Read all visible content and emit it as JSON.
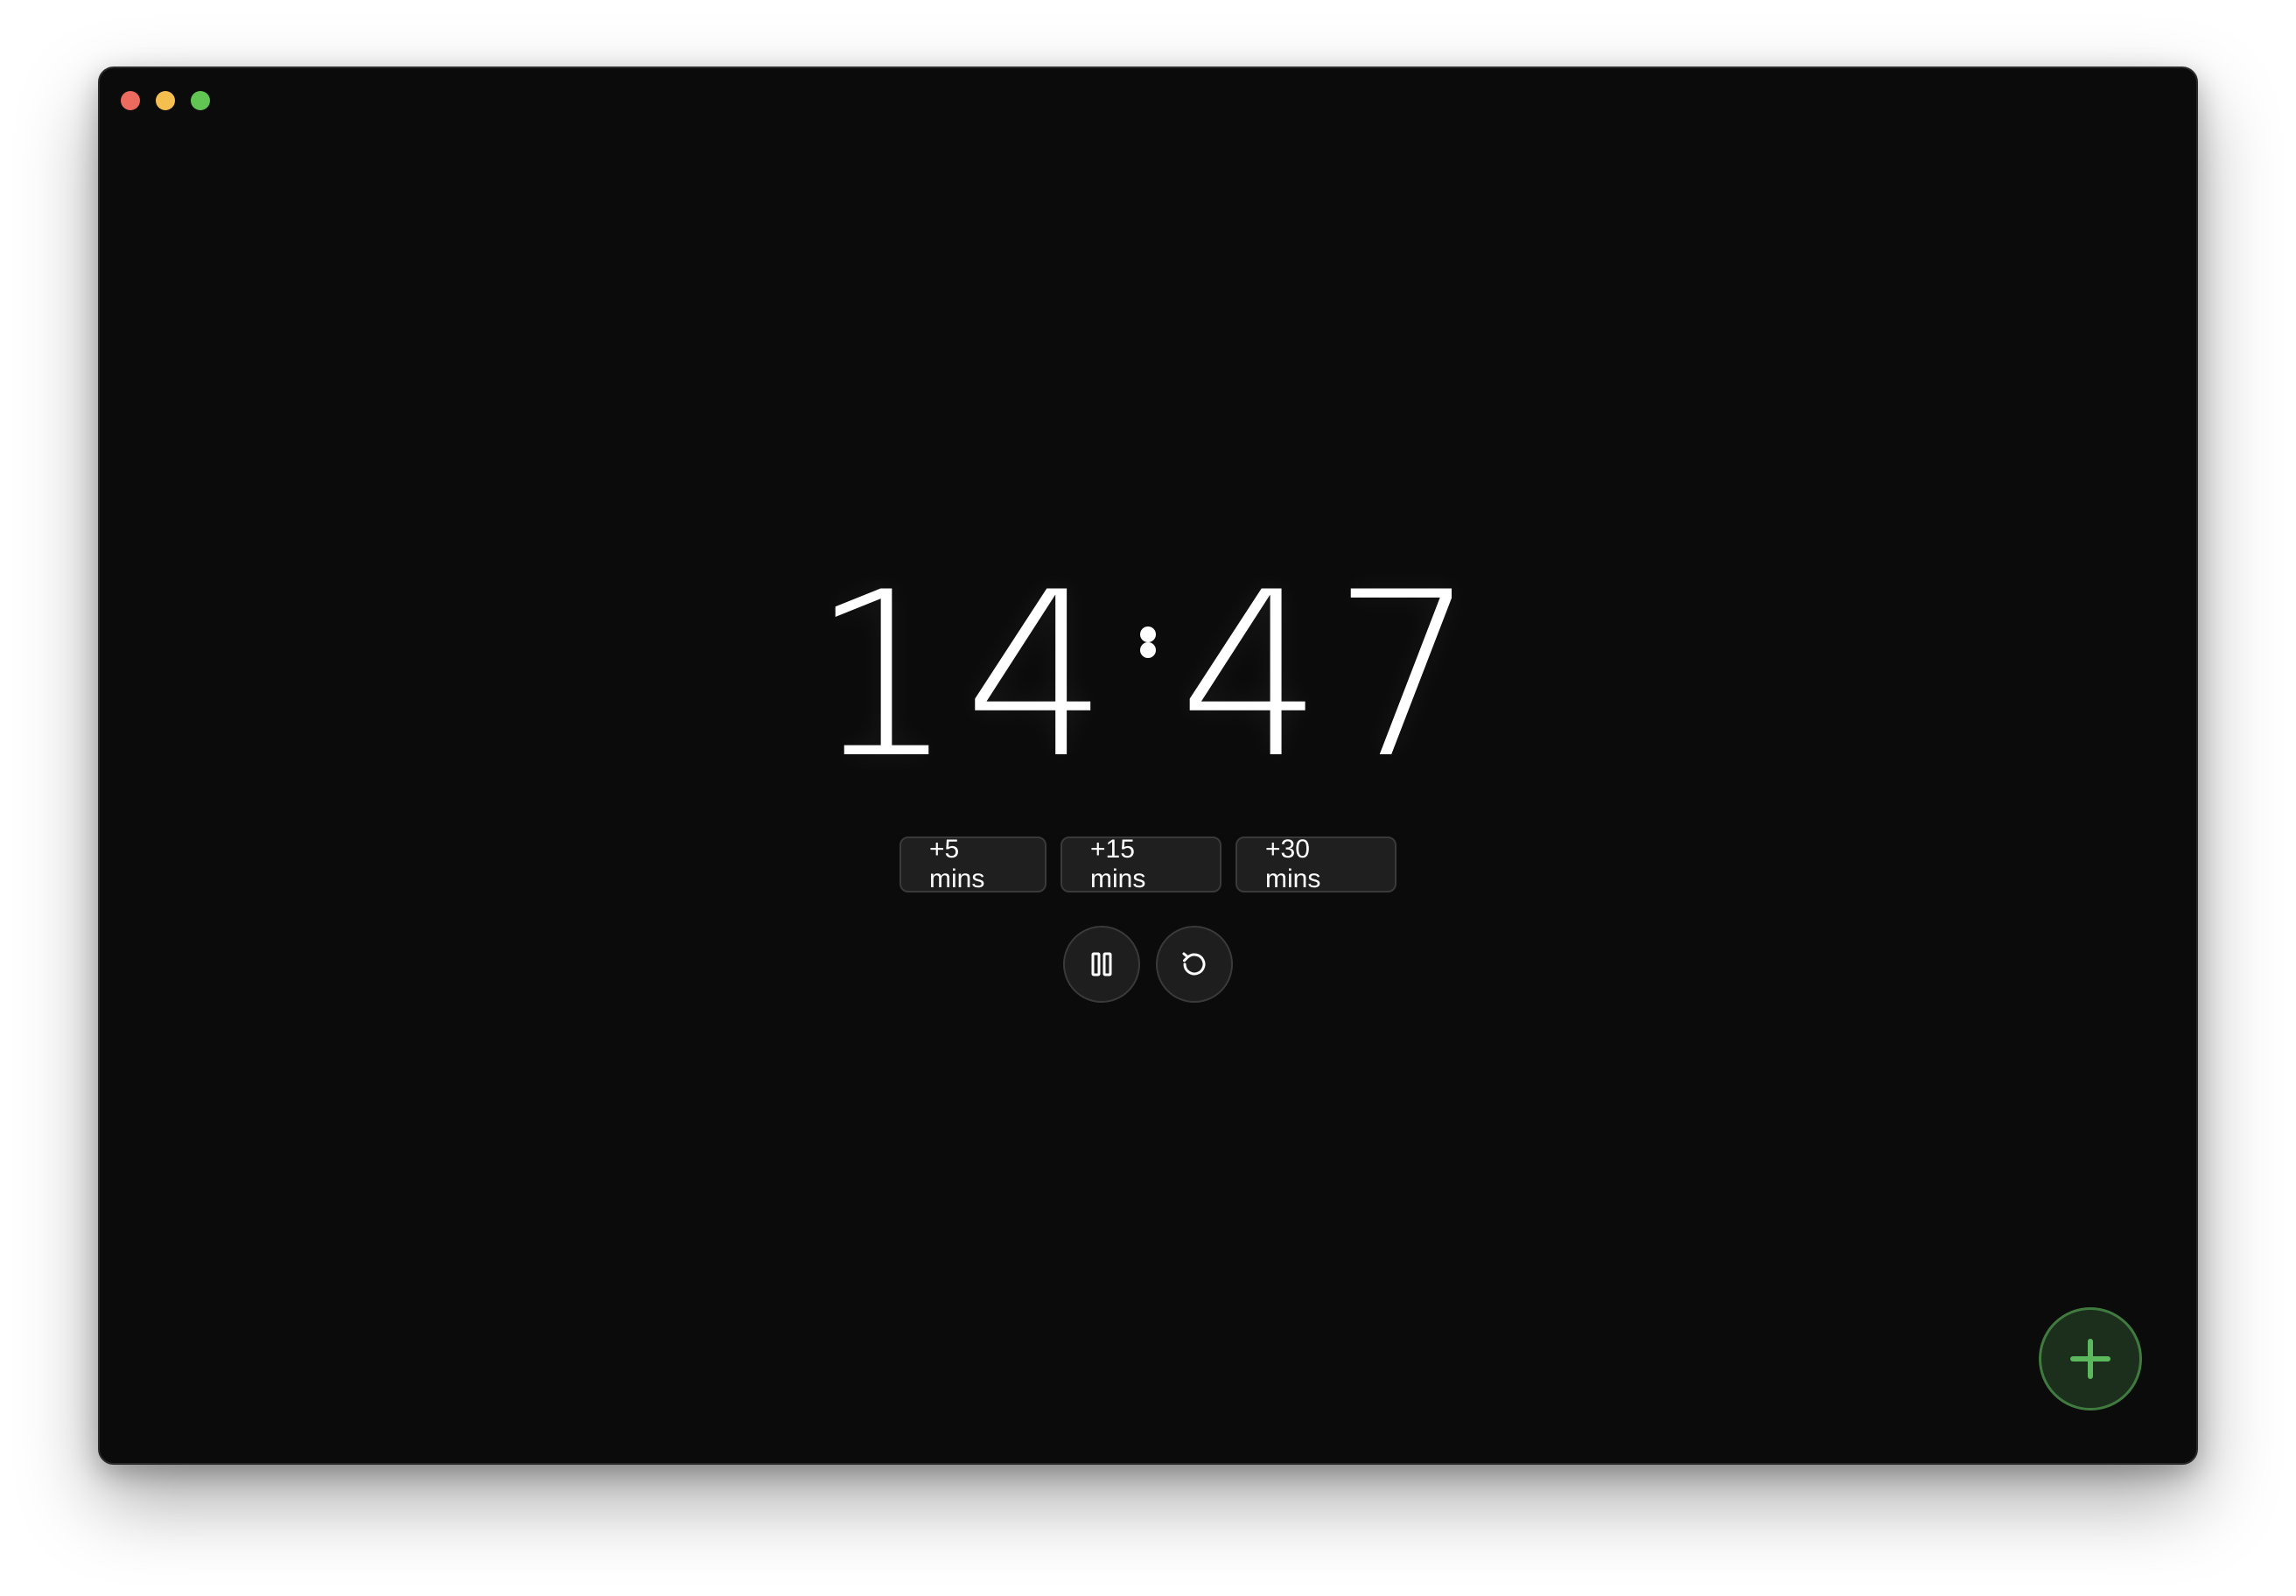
{
  "window": {
    "traffic_lights": [
      {
        "name": "close",
        "color": "#ec6a5e"
      },
      {
        "name": "minimize",
        "color": "#f4bf4f"
      },
      {
        "name": "zoom",
        "color": "#61c554"
      }
    ]
  },
  "timer": {
    "hours": "14",
    "minutes": "47"
  },
  "presets": [
    {
      "label": "+5 mins"
    },
    {
      "label": "+15 mins"
    },
    {
      "label": "+30 mins"
    }
  ],
  "controls": {
    "pause_icon": "pause-icon",
    "reset_icon": "reset-icon"
  },
  "fab": {
    "icon": "plus-icon",
    "accent": "#5cb85c"
  }
}
